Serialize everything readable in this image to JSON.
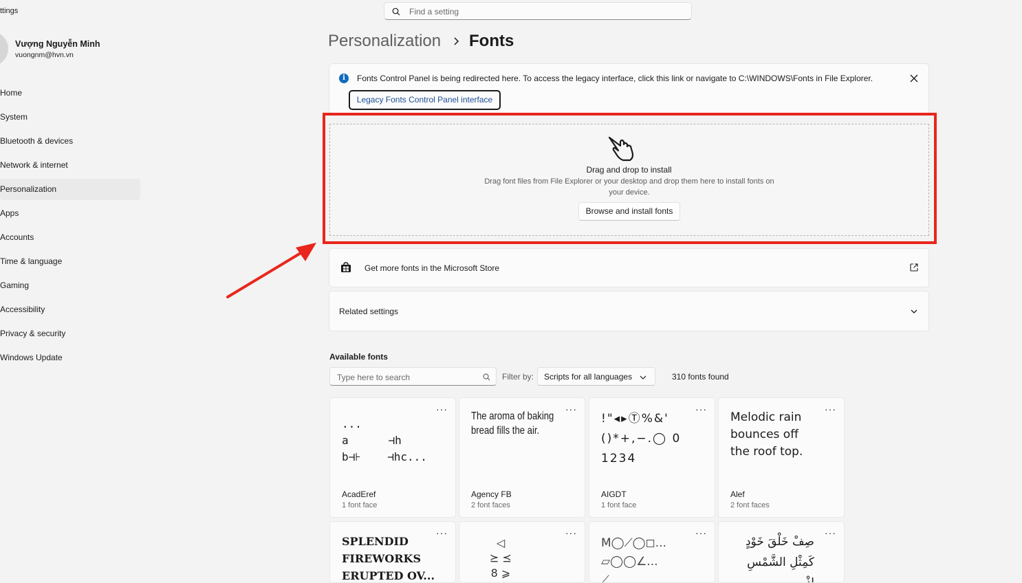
{
  "app": {
    "title": "ttings"
  },
  "user": {
    "name": "Vượng Nguyễn Minh",
    "email": "vuongnm@hvn.vn"
  },
  "sidebar": {
    "items": [
      {
        "label": "Home"
      },
      {
        "label": "System"
      },
      {
        "label": "Bluetooth & devices"
      },
      {
        "label": "Network & internet"
      },
      {
        "label": "Personalization",
        "selected": true
      },
      {
        "label": "Apps"
      },
      {
        "label": "Accounts"
      },
      {
        "label": "Time & language"
      },
      {
        "label": "Gaming"
      },
      {
        "label": "Accessibility"
      },
      {
        "label": "Privacy & security"
      },
      {
        "label": "Windows Update"
      }
    ]
  },
  "search": {
    "placeholder": "Find a setting",
    "icon": "search-icon"
  },
  "breadcrumb": {
    "parent": "Personalization",
    "separator_icon": "chevron-right-icon",
    "current": "Fonts"
  },
  "info_bar": {
    "icon": "info-icon",
    "text": "Fonts Control Panel is being redirected here. To access the legacy interface, click this link or navigate to C:\\WINDOWS\\Fonts in File Explorer.",
    "button_label": "Legacy Fonts Control Panel interface",
    "close_icon": "close-icon"
  },
  "drop_zone": {
    "icon": "hand-pointer-icon",
    "title": "Drag and drop to install",
    "description": "Drag font files from File Explorer or your desktop and drop them here to install fonts on your device.",
    "button_label": "Browse and install fonts"
  },
  "annotation": {
    "highlight_color": "#e8261c",
    "arrow_color": "#e8261c"
  },
  "store": {
    "icon": "store-icon",
    "label": "Get more fonts in the Microsoft Store",
    "action_icon": "external-link-icon"
  },
  "related": {
    "label": "Related settings",
    "icon": "chevron-down-icon"
  },
  "available": {
    "title": "Available fonts",
    "search_placeholder": "Type here to search",
    "filter_label": "Filter by:",
    "filter_value": "Scripts for all languages",
    "count_text": "310 fonts found"
  },
  "fonts": [
    {
      "name": "AcadEref",
      "faces": "1 font face",
      "sample": "...\na      ⊣h\nb⊣⊦    ⊣hc..."
    },
    {
      "name": "Agency FB",
      "faces": "2 font faces",
      "sample": "The aroma of baking\nbread fills the air."
    },
    {
      "name": "AIGDT",
      "faces": "1 font face",
      "sample": "!\"◂▸Ⓣ%&'\n()*+,−.◯ 0\n1234"
    },
    {
      "name": "Alef",
      "faces": "2 font faces",
      "sample": "Melodic rain\nbounces off\nthe roof top."
    },
    {
      "name": "",
      "faces": "",
      "sample": "SPLENDID\nFIREWORKS\nERUPTED OV..."
    },
    {
      "name": "",
      "faces": "",
      "sample": "◁\n⪰ ⪯\n8 ⩾"
    },
    {
      "name": "",
      "faces": "",
      "sample": "M◯⟋◯◻...\n▱◯◯∠...\n⟋"
    },
    {
      "name": "",
      "faces": "",
      "sample": "صِفْ خَلْقَ خَوْدٍ\nكَمِثْلِ الشَّمْسِ إِذْ..."
    }
  ],
  "more_label": "···"
}
